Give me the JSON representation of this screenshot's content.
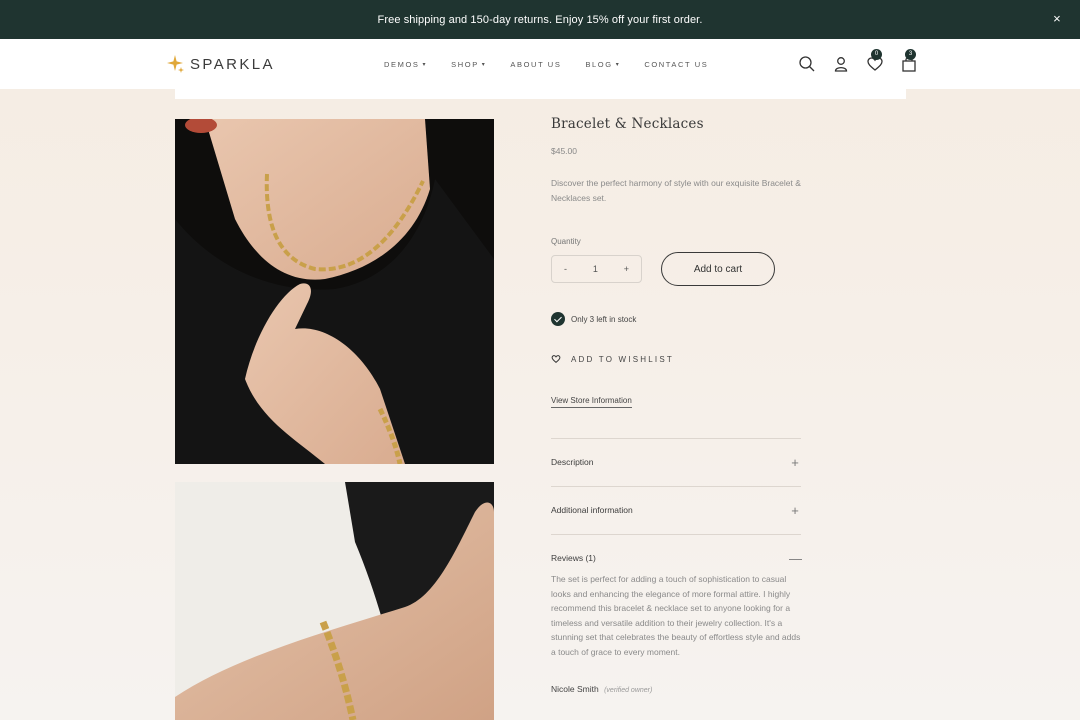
{
  "announcement": {
    "text": "Free shipping and 150-day returns. Enjoy 15% off your first order.",
    "close_glyph": "×"
  },
  "header": {
    "logo_text": "SPARKLA",
    "nav": [
      {
        "label": "DEMOS",
        "has_dropdown": true
      },
      {
        "label": "SHOP",
        "has_dropdown": true
      },
      {
        "label": "ABOUT US",
        "has_dropdown": false
      },
      {
        "label": "BLOG",
        "has_dropdown": true
      },
      {
        "label": "CONTACT US",
        "has_dropdown": false
      }
    ],
    "icons": {
      "search": "search-icon",
      "account": "user-icon",
      "wishlist": "heart-icon",
      "cart": "bag-icon"
    },
    "wishlist_count": "0",
    "cart_count": "3"
  },
  "product": {
    "title": "Bracelet & Necklaces",
    "price": "$45.00",
    "description": "Discover the perfect harmony of style with our exquisite Bracelet & Necklaces set.",
    "quantity_label": "Quantity",
    "quantity_minus": "-",
    "quantity_value": "1",
    "quantity_plus": "+",
    "add_to_cart": "Add to cart",
    "stock": "Only 3 left in stock",
    "wishlist": "ADD TO WISHLIST",
    "store_info": "View Store Information"
  },
  "accordion": [
    {
      "label": "Description",
      "sign": "+",
      "expanded": false
    },
    {
      "label": "Additional information",
      "sign": "+",
      "expanded": false
    },
    {
      "label": "Reviews (1)",
      "sign": "—",
      "expanded": true
    }
  ],
  "review": {
    "text": "The set is perfect for adding a touch of sophistication to casual looks and enhancing the elegance of more formal attire. I highly recommend this bracelet & necklace set to anyone looking for a timeless and versatile addition to their jewelry collection. It's a stunning set that celebrates the beauty of effortless style and adds a touch of grace to every moment.",
    "author": "Nicole Smith",
    "badge": "(verified owner)"
  },
  "colors": {
    "accent_dark": "#1f3430",
    "gold": "#c9a04a"
  }
}
